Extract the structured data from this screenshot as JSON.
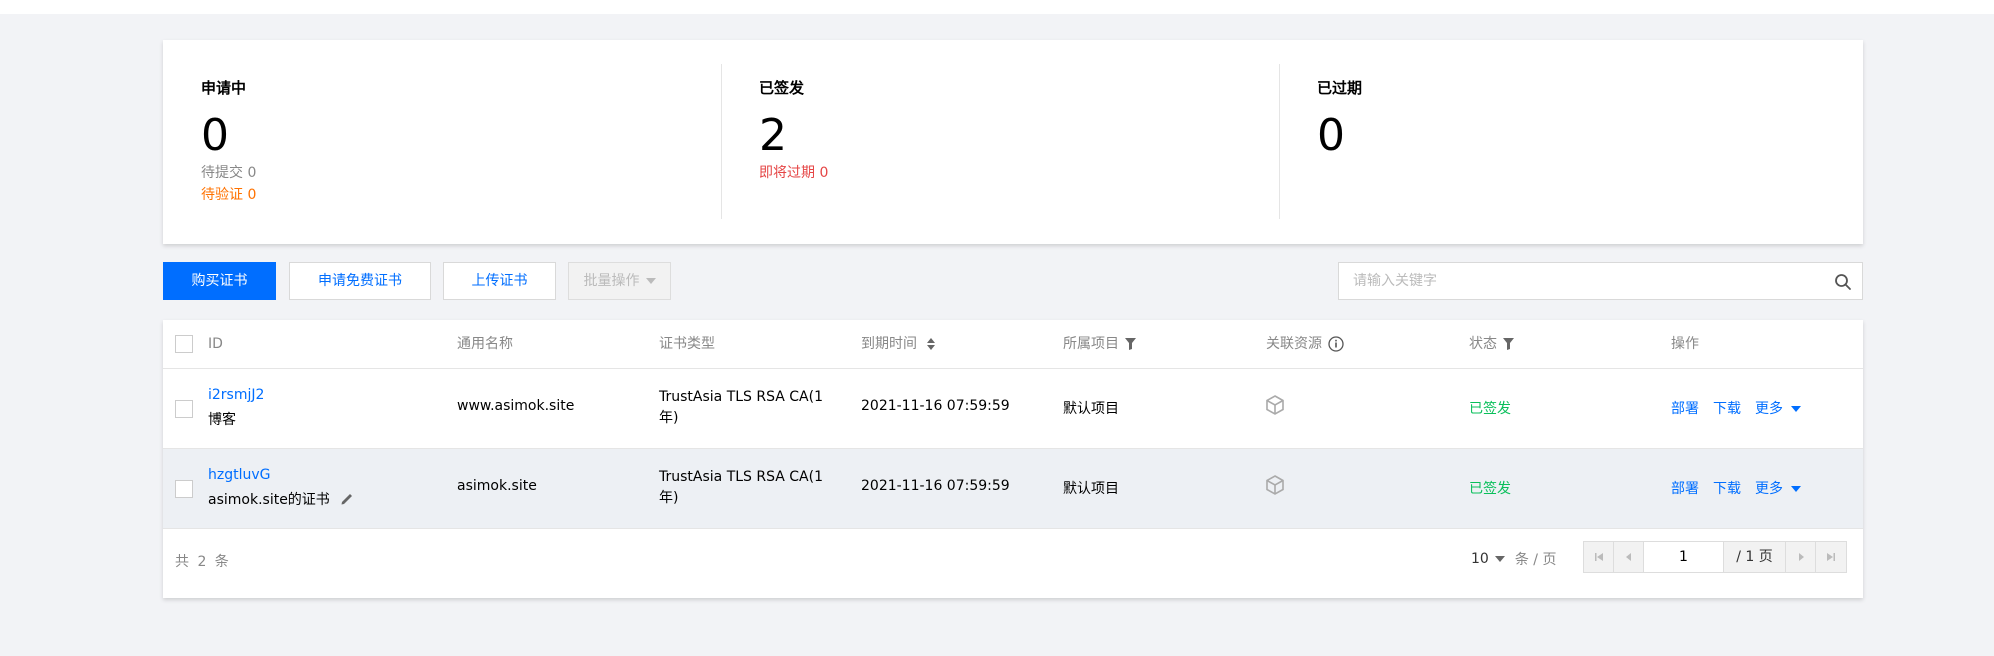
{
  "summary": {
    "applying": {
      "title": "申请中",
      "count": "0",
      "sub1": "待提交 0",
      "sub2": "待验证 0"
    },
    "issued": {
      "title": "已签发",
      "count": "2",
      "sub1": "即将过期 0"
    },
    "expired": {
      "title": "已过期",
      "count": "0"
    }
  },
  "toolbar": {
    "buy_label": "购买证书",
    "free_label": "申请免费证书",
    "upload_label": "上传证书",
    "batch_label": "批量操作",
    "search_placeholder": "请输入关键字"
  },
  "table": {
    "columns": {
      "id": "ID",
      "common_name": "通用名称",
      "cert_type": "证书类型",
      "expiry": "到期时间",
      "project": "所属项目",
      "resources": "关联资源",
      "status": "状态",
      "actions": "操作"
    },
    "rows": [
      {
        "id": "i2rsmjJ2",
        "remark": "博客",
        "common_name": "www.asimok.site",
        "cert_type_line1": "TrustAsia TLS RSA CA(1",
        "cert_type_line2": "年)",
        "expiry": "2021-11-16 07:59:59",
        "project": "默认项目",
        "status": "已签发",
        "deploy": "部署",
        "download": "下载",
        "more": "更多"
      },
      {
        "id": "hzgtluvG",
        "remark": "asimok.site的证书",
        "common_name": "asimok.site",
        "cert_type_line1": "TrustAsia TLS RSA CA(1",
        "cert_type_line2": "年)",
        "expiry": "2021-11-16 07:59:59",
        "project": "默认项目",
        "status": "已签发",
        "deploy": "部署",
        "download": "下载",
        "more": "更多"
      }
    ],
    "footer": {
      "total": "共 2 条",
      "page_size": "10",
      "per_page": "条 / 页",
      "page": "1",
      "page_total": "/ 1 页"
    }
  },
  "colors": {
    "primary": "#006eff",
    "success": "#0abf5b",
    "warning": "#ff7200",
    "danger": "#e54545"
  }
}
